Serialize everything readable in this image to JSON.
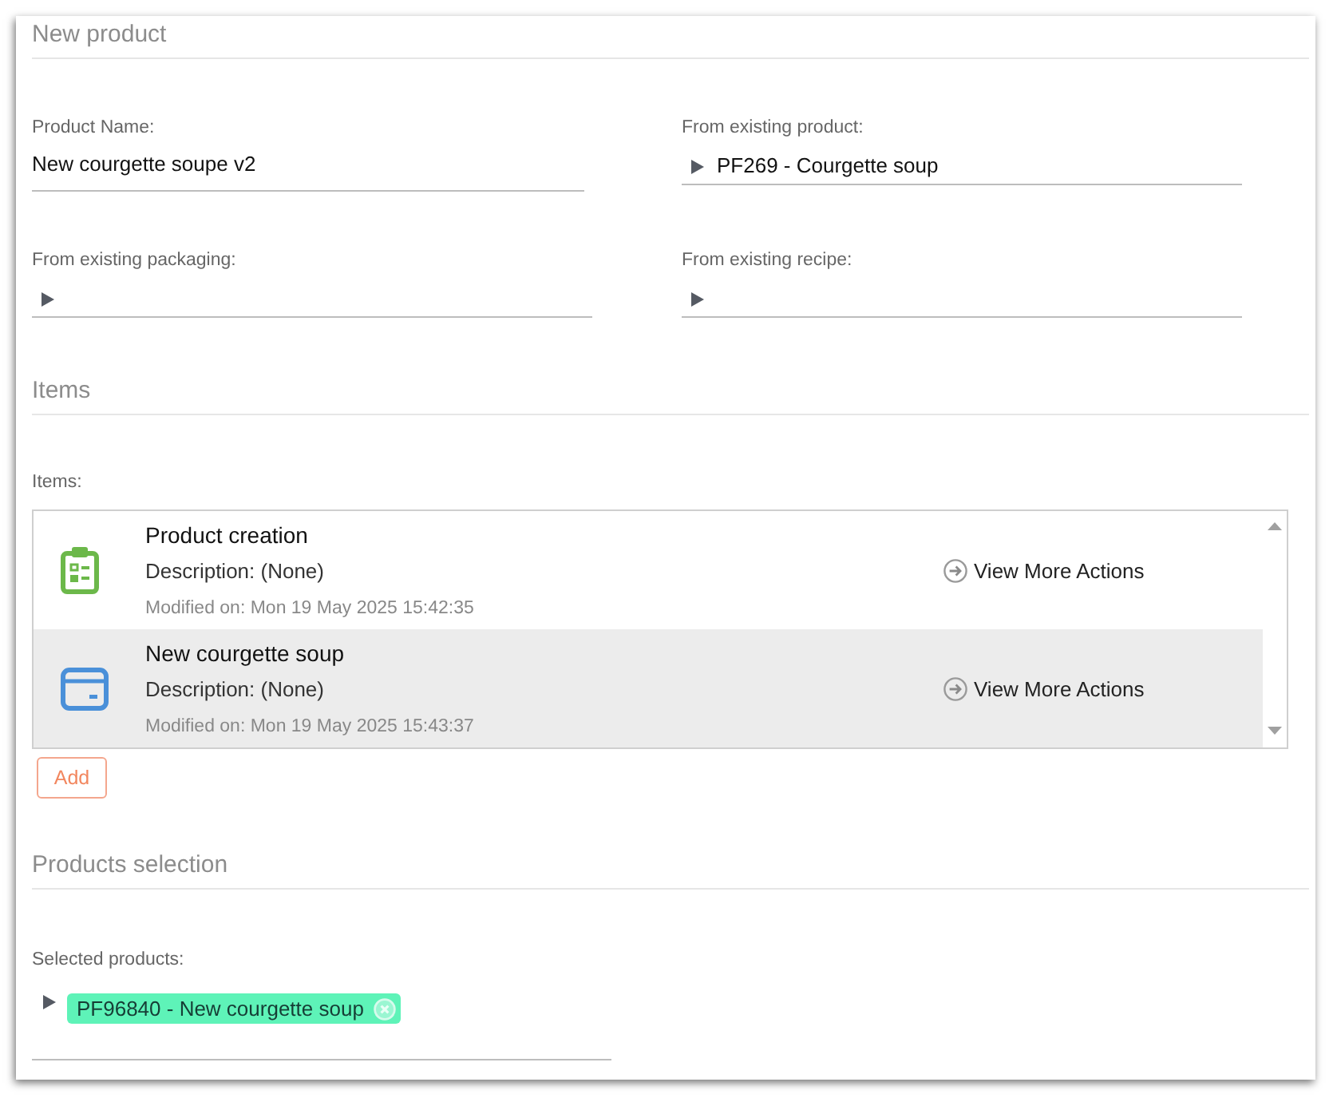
{
  "form": {
    "title": "New product",
    "fields": [
      {
        "kind": "text",
        "label": "Product Name:",
        "value": "New courgette soupe v2"
      },
      {
        "kind": "picker",
        "label": "From existing product:",
        "value": "PF269 - Courgette soup"
      },
      {
        "kind": "picker",
        "label": "From existing packaging:"
      },
      {
        "kind": "picker",
        "label": "From existing recipe:"
      }
    ]
  },
  "items": {
    "title": "Items",
    "label": "Items:",
    "list": [
      {
        "kind": "checklist",
        "title": "Product creation",
        "description": "Description: (None)",
        "modified": "Modified on: Mon 19 May 2025 15:42:35",
        "action": "View More Actions",
        "selected": false
      },
      {
        "kind": "package",
        "title": "New courgette soup",
        "description": "Description: (None)",
        "modified": "Modified on: Mon 19 May 2025 15:43:37",
        "action": "View More Actions",
        "selected": true
      }
    ],
    "add_button": "Add"
  },
  "products_selection": {
    "title": "Products selection",
    "label": "Selected products:",
    "chips": [
      {
        "label": "PF96840 - New courgette soup"
      }
    ]
  }
}
